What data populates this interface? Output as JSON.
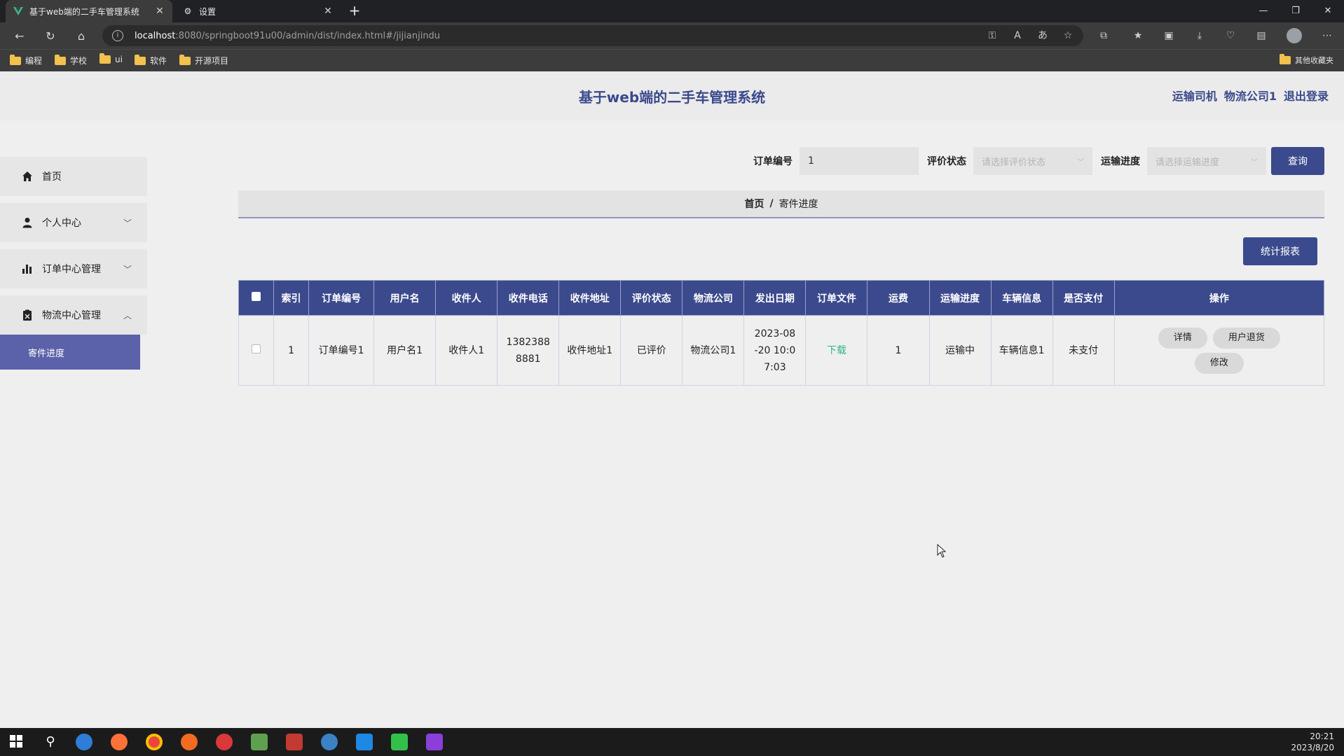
{
  "browser": {
    "tabs": [
      {
        "title": "基于web端的二手车管理系统",
        "active": true
      },
      {
        "title": "设置",
        "active": false
      }
    ],
    "url_host": "localhost",
    "url_path": ":8080/springboot91u00/admin/dist/index.html#/jijianjindu",
    "bookmarks": [
      "编程",
      "学校",
      "ui",
      "软件",
      "开源项目"
    ],
    "other_bookmarks": "其他收藏夹"
  },
  "header": {
    "title": "基于web端的二手车管理系统",
    "role": "运输司机",
    "user": "物流公司1",
    "logout": "退出登录"
  },
  "sidebar": {
    "items": [
      {
        "label": "首页",
        "icon": "home-icon"
      },
      {
        "label": "个人中心",
        "icon": "user-icon"
      },
      {
        "label": "订单中心管理",
        "icon": "chart-icon"
      },
      {
        "label": "物流中心管理",
        "icon": "clipboard-icon"
      }
    ],
    "sub_active": "寄件进度"
  },
  "search": {
    "order_label": "订单编号",
    "order_value": "1",
    "eval_label": "评价状态",
    "eval_placeholder": "请选择评价状态",
    "progress_label": "运输进度",
    "progress_placeholder": "请选择运输进度",
    "query": "查询"
  },
  "breadcrumb": {
    "home": "首页",
    "sep": "/",
    "current": "寄件进度"
  },
  "actions": {
    "stats": "统计报表"
  },
  "table": {
    "headers": [
      "索引",
      "订单编号",
      "用户名",
      "收件人",
      "收件电话",
      "收件地址",
      "评价状态",
      "物流公司",
      "发出日期",
      "订单文件",
      "运费",
      "运输进度",
      "车辆信息",
      "是否支付",
      "操作"
    ],
    "rows": [
      {
        "index": "1",
        "order_no": "订单编号1",
        "username": "用户名1",
        "receiver": "收件人1",
        "phone": "13823888881",
        "address": "收件地址1",
        "eval": "已评价",
        "company": "物流公司1",
        "date": "2023-08-20 10:07:03",
        "file": "下载",
        "fee": "1",
        "progress": "运输中",
        "vehicle": "车辆信息1",
        "paid": "未支付",
        "ops": [
          "详情",
          "用户退货",
          "修改"
        ]
      }
    ]
  },
  "taskbar": {
    "time": "20:21",
    "date": "2023/8/20"
  },
  "colors": {
    "primary": "#3b4a8c",
    "submenu": "#5b62a9",
    "download": "#2fb88a"
  }
}
